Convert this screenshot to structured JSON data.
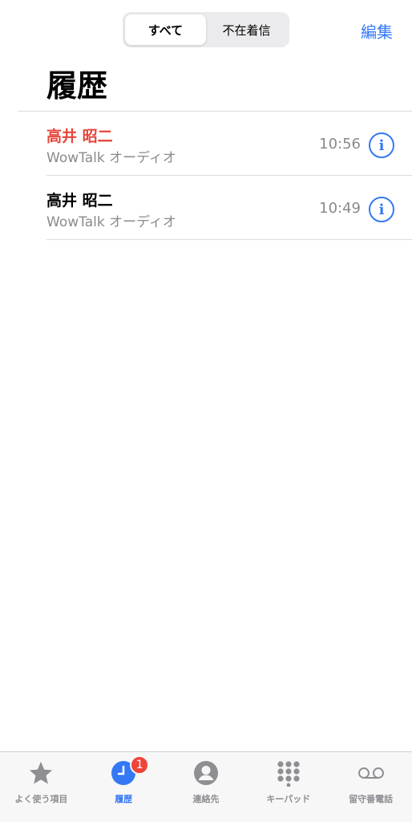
{
  "segment": {
    "all_label": "すべて",
    "missed_label": "不在着信"
  },
  "header": {
    "edit_label": "編集",
    "title": "履歴"
  },
  "calls": [
    {
      "name": "高井 昭二",
      "type": "WowTalk オーディオ",
      "time": "10:56",
      "missed": true
    },
    {
      "name": "高井 昭二",
      "type": "WowTalk オーディオ",
      "time": "10:49",
      "missed": false
    }
  ],
  "tabbar": {
    "tabs": [
      {
        "label": "よく使う項目",
        "icon": "star-icon"
      },
      {
        "label": "履歴",
        "icon": "clock-icon",
        "badge": "1",
        "active": true
      },
      {
        "label": "連絡先",
        "icon": "person-icon"
      },
      {
        "label": "キーパッド",
        "icon": "keypad-icon"
      },
      {
        "label": "留守番電話",
        "icon": "voicemail-icon"
      }
    ]
  },
  "colors": {
    "accent": "#3478f6",
    "missed": "#e8463c",
    "badge": "#f0433a",
    "secondary_text": "#8a8a8e"
  }
}
